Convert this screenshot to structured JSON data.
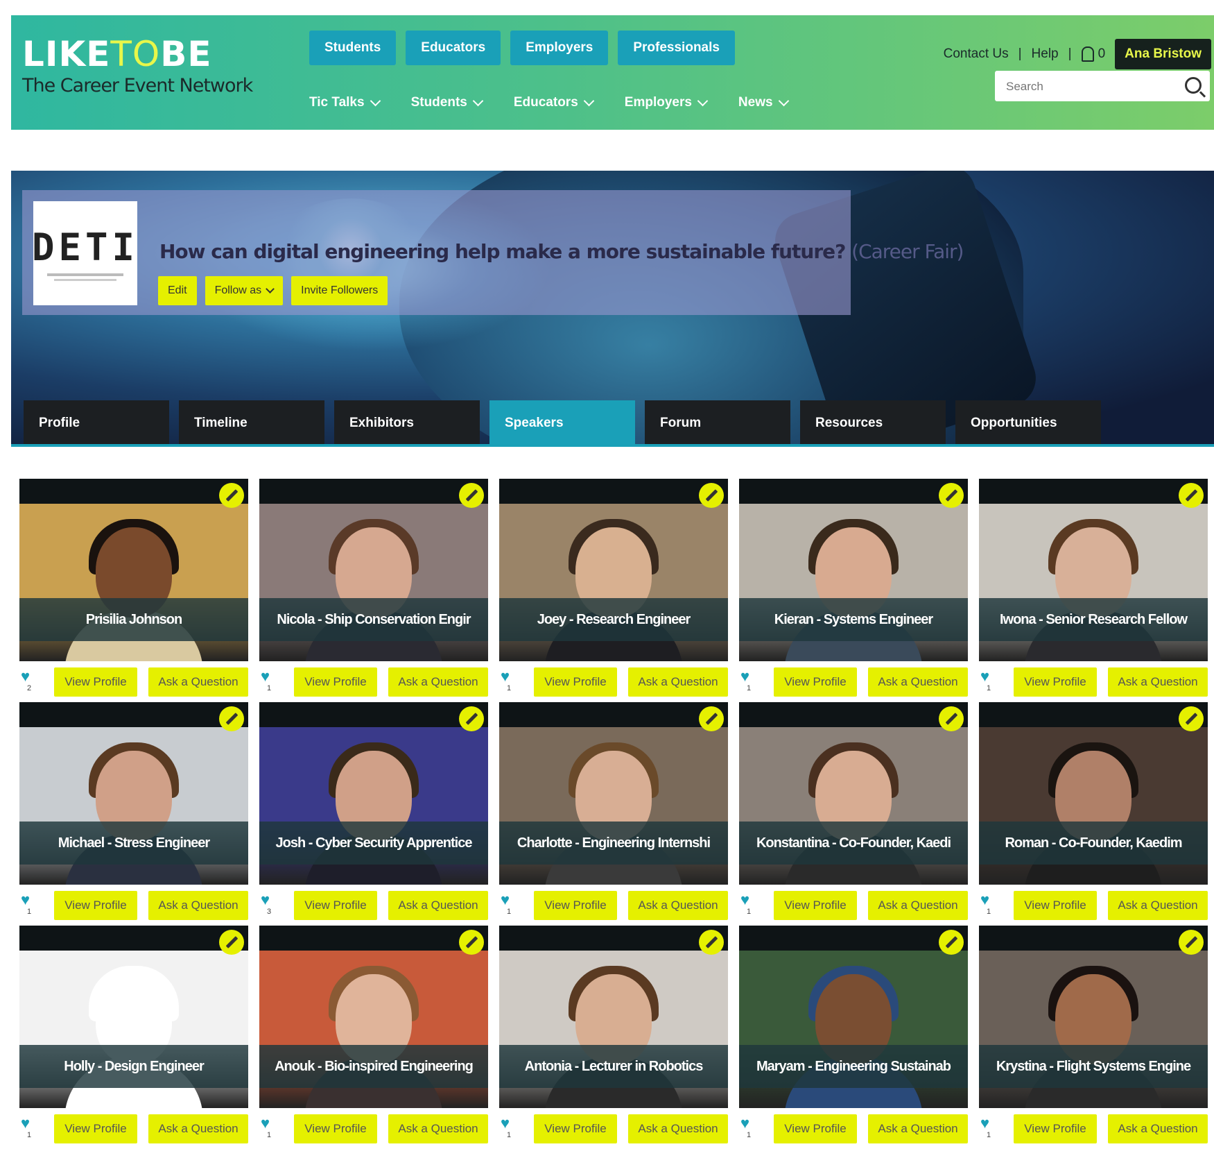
{
  "brand": {
    "logo_like": "LIKE",
    "logo_to": "TO",
    "logo_be": "BE",
    "tagline": "The Career Event Network"
  },
  "audience_nav": [
    "Students",
    "Educators",
    "Employers",
    "Professionals"
  ],
  "main_nav": [
    "Tic Talks",
    "Students",
    "Educators",
    "Employers",
    "News"
  ],
  "utility": {
    "contact": "Contact Us",
    "help": "Help",
    "notifications": "0",
    "user": "Ana Bristow"
  },
  "search": {
    "placeholder": "Search"
  },
  "event": {
    "logo_text": "DETI",
    "title": "How can digital engineering help make a more sustainable future?",
    "type": "(Career Fair)",
    "edit": "Edit",
    "follow": "Follow as",
    "invite": "Invite Followers"
  },
  "tabs": [
    "Profile",
    "Timeline",
    "Exhibitors",
    "Speakers",
    "Forum",
    "Resources",
    "Opportunities"
  ],
  "active_tab": "Speakers",
  "card_actions": {
    "view": "View Profile",
    "ask": "Ask a Question"
  },
  "speakers": [
    {
      "name": "Prisilia Johnson",
      "likes": "2",
      "bg": "#c9a050",
      "skin": "#7a4a2c",
      "hair": "#1a120e",
      "shirt": "#d9c9a0"
    },
    {
      "name": "Nicola - Ship Conservation Engir",
      "likes": "1",
      "bg": "#8a7a78",
      "skin": "#d6a890",
      "hair": "#5a3a28",
      "shirt": "#2a2a32"
    },
    {
      "name": "Joey - Research Engineer",
      "likes": "1",
      "bg": "#9a8468",
      "skin": "#d8b090",
      "hair": "#3a2a1e",
      "shirt": "#1e1e22"
    },
    {
      "name": "Kieran - Systems Engineer",
      "likes": "1",
      "bg": "#b8b2a8",
      "skin": "#d8aa90",
      "hair": "#3a2a1c",
      "shirt": "#3a4a5a"
    },
    {
      "name": "Iwona - Senior Research Fellow",
      "likes": "1",
      "bg": "#c8c4bc",
      "skin": "#d8b098",
      "hair": "#5a3a22",
      "shirt": "#2a2a2e"
    },
    {
      "name": "Michael - Stress Engineer",
      "likes": "1",
      "bg": "#c8ccd0",
      "skin": "#d0a088",
      "hair": "#5a3a22",
      "shirt": "#2a3040"
    },
    {
      "name": "Josh - Cyber Security Apprentice",
      "likes": "3",
      "bg": "#3a3a8a",
      "skin": "#d0a088",
      "hair": "#3a2a1a",
      "shirt": "#1e1e2a"
    },
    {
      "name": "Charlotte - Engineering Internshi",
      "likes": "1",
      "bg": "#7a6a5a",
      "skin": "#d8ae94",
      "hair": "#6a4a2a",
      "shirt": "#3a3a3a"
    },
    {
      "name": "Konstantina - Co-Founder, Kaedi",
      "likes": "1",
      "bg": "#8a8078",
      "skin": "#d8ac92",
      "hair": "#4a3020",
      "shirt": "#2a2a2a"
    },
    {
      "name": "Roman - Co-Founder, Kaedim",
      "likes": "1",
      "bg": "#4a3a32",
      "skin": "#b08068",
      "hair": "#1a1410",
      "shirt": "#1e1e1e"
    },
    {
      "name": "Holly - Design Engineer",
      "likes": "1",
      "bg": "#f2f2f2",
      "skin": "#ffffff",
      "hair": "#ffffff",
      "shirt": "#ffffff"
    },
    {
      "name": "Anouk - Bio-inspired Engineering",
      "likes": "1",
      "bg": "#c85a3a",
      "skin": "#e0b49a",
      "hair": "#8a5a34",
      "shirt": "#3a3030"
    },
    {
      "name": "Antonia - Lecturer in Robotics",
      "likes": "1",
      "bg": "#cfcac4",
      "skin": "#d8ae92",
      "hair": "#5a3a22",
      "shirt": "#2a2a2a"
    },
    {
      "name": "Maryam - Engineering Sustainab",
      "likes": "1",
      "bg": "#3a5a3a",
      "skin": "#7a4e32",
      "hair": "#2a4a7a",
      "shirt": "#2a4a7a"
    },
    {
      "name": "Krystina - Flight Systems Engine",
      "likes": "1",
      "bg": "#6a6058",
      "skin": "#a06a4a",
      "hair": "#1a1210",
      "shirt": "#2a2a2a"
    }
  ]
}
